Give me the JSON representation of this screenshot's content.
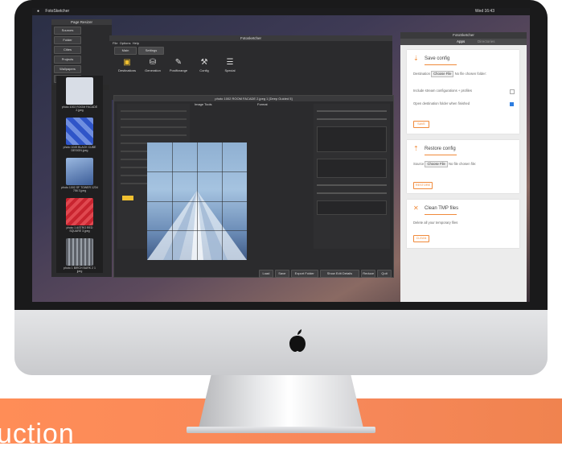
{
  "menubar": {
    "app_name": "FotoSketcher",
    "clock": "Wed 16:43"
  },
  "left_panel": {
    "title": "Page Resizer",
    "tabs": [
      "Sources",
      "Folder",
      "Cities",
      "Projects",
      "Wallpapers",
      "Decoration"
    ],
    "header": "Page Features",
    "thumbnails": [
      {
        "caption": "photo 1002 ROOM FACADE 2.jpeg",
        "color": "#d8dde6"
      },
      {
        "caption": "photo 1049 BLACK CUBE DESIGN.jpeg",
        "color": "#2f55c8"
      },
      {
        "caption": "photo 1002 SF TOWER 1234 756 3 jpeg",
        "color": "#5a7bb0"
      },
      {
        "caption": "photo 1 ASTRO RED SQUARE 3.jpeg",
        "color": "#c8242f"
      },
      {
        "caption": "photo 1 BIRCH BARK 2 1 jpeg",
        "color": "#5d6168"
      }
    ]
  },
  "main_window": {
    "title": "Fotosketcher",
    "menu": [
      "File",
      "Options",
      "Help"
    ],
    "tabs": [
      "Main",
      "Settings"
    ],
    "tools": [
      {
        "icon": "briefcase-icon",
        "label": "Destinations"
      },
      {
        "icon": "database-icon",
        "label": "Generation"
      },
      {
        "icon": "wrench-icon",
        "label": "Postfixrange"
      },
      {
        "icon": "tools-icon",
        "label": "Config"
      },
      {
        "icon": "list-icon",
        "label": "Special"
      }
    ]
  },
  "editor_window": {
    "title": "photo 1002 ROOM FACADE 2.jpeg 1 [Deep Guided 5]",
    "image_tools_label": "Image Tools",
    "format_label": "Format",
    "bottom_buttons": [
      "Load",
      "Save",
      "Export Folder",
      "Show Edit Details",
      "Reduce",
      "Quit"
    ]
  },
  "right_panel": {
    "title": "FotoSketcher",
    "tabs": [
      "Apps",
      "Directories"
    ],
    "cards": [
      {
        "icon": "download-icon",
        "title": "Save config",
        "line1_pre": "Destination",
        "choose_label": "Choose File",
        "line1_post": "No file chosen",
        "line1_tail": "folder:",
        "option1": "Include stream configurations + profiles",
        "option2": "Open destination folder when finished",
        "button": "SAVE"
      },
      {
        "icon": "upload-icon",
        "title": "Restore config",
        "line1_pre": "Source",
        "choose_label": "Choose File",
        "line1_post": "No file chosen",
        "line1_tail": "file:",
        "button": "RESTORE"
      },
      {
        "icon": "close-icon",
        "title": "Clean TMP files",
        "line1_pre": "Delete all your temporary files",
        "button": "CLEAN"
      }
    ]
  },
  "banner": {
    "text": "uction"
  },
  "colors": {
    "accent": "#f08a3a",
    "banner": "#f7885a",
    "tool_icon": "#f0c030"
  }
}
